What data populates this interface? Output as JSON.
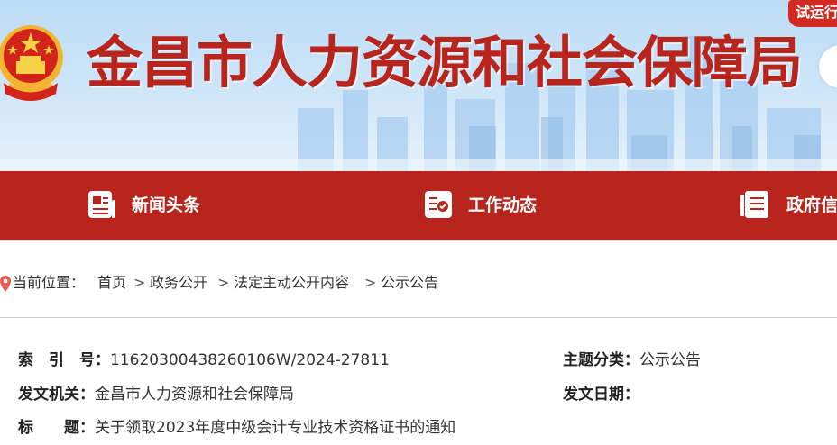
{
  "header": {
    "site_title": "金昌市人力资源和社会保障局",
    "trial_badge": "试运行",
    "title_color": "#b7251d"
  },
  "nav": {
    "background_color": "#b7251d",
    "items": [
      {
        "label": "新闻头条",
        "icon": "news-icon"
      },
      {
        "label": "工作动态",
        "icon": "work-dynamics-icon"
      },
      {
        "label": "政府信",
        "icon": "gov-info-icon"
      }
    ]
  },
  "breadcrumb": {
    "prefix": "当前位置：",
    "items": [
      "首页",
      "政务公开",
      "法定主动公开内容",
      "公示公告"
    ],
    "separator": ">"
  },
  "meta": {
    "index_label": "索　引　号：",
    "index_value": "11620300438260106W/2024-27811",
    "topic_label": "主题分类：",
    "topic_value": "公示公告",
    "issuer_label": "发文机关：",
    "issuer_value": "金昌市人力资源和社会保障局",
    "date_label": "发文日期：",
    "date_value": "",
    "title_label": "标　　题：",
    "title_value": "关于领取2023年度中级会计专业技术资格证书的通知"
  }
}
